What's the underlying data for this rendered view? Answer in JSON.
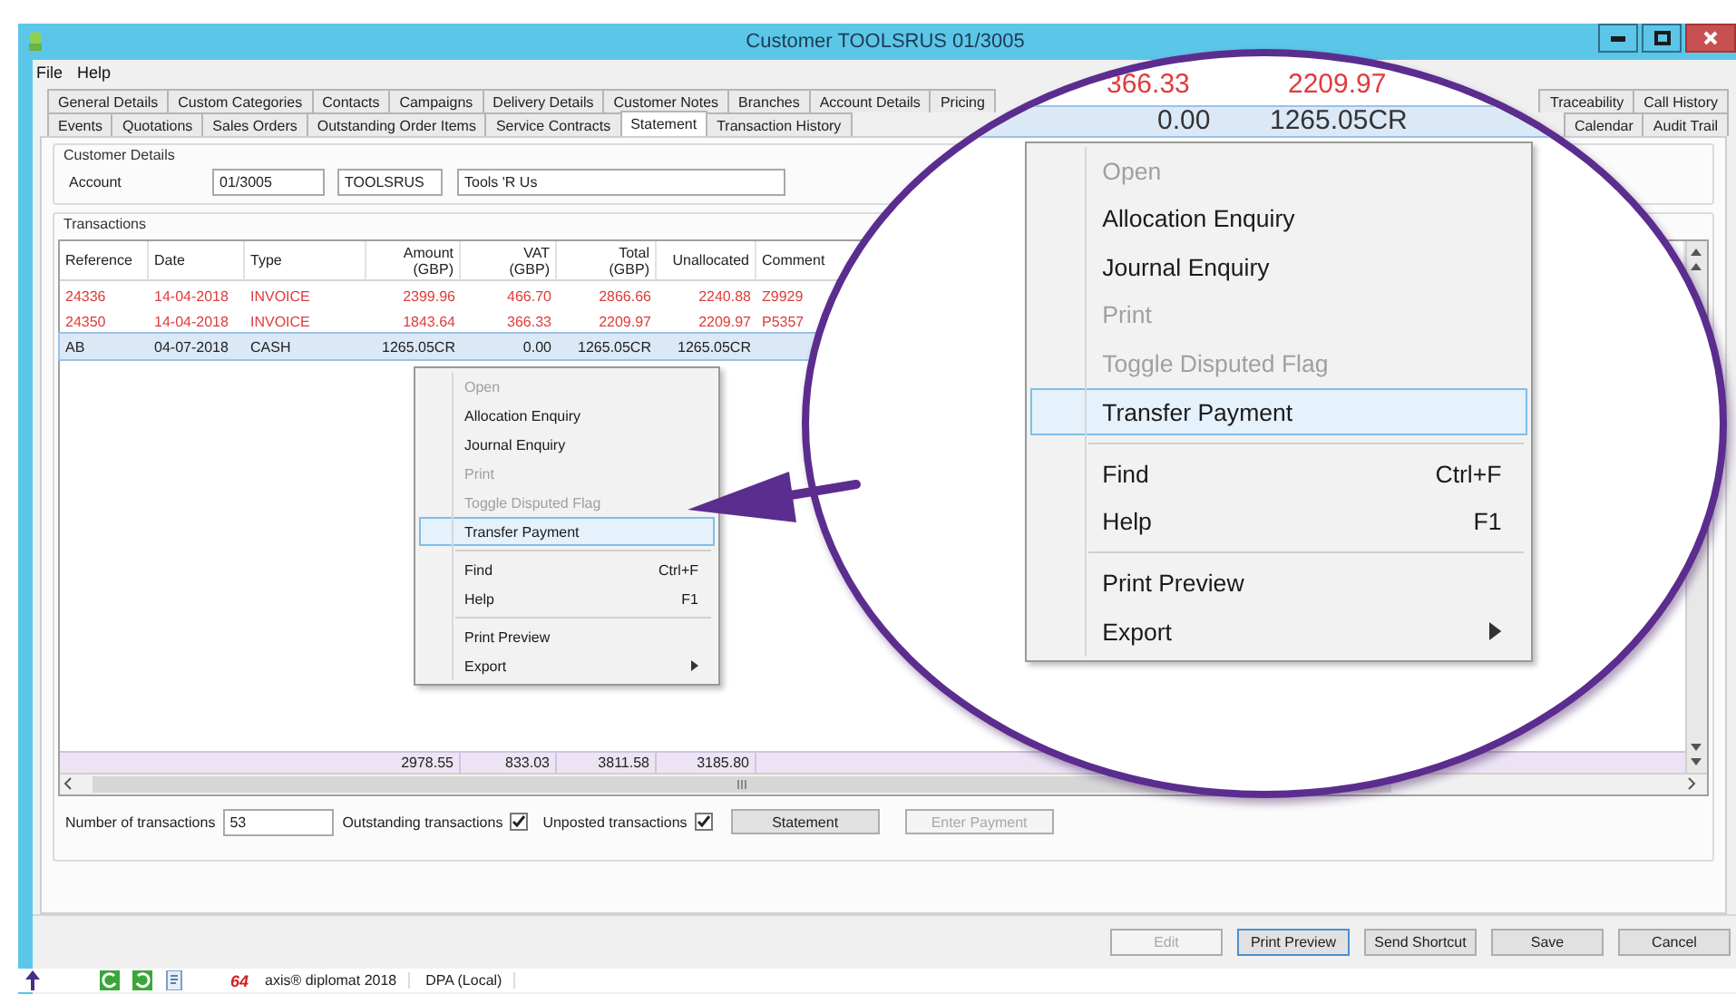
{
  "window": {
    "title": "Customer TOOLSRUS 01/3005"
  },
  "menu_bar": [
    "File",
    "Help"
  ],
  "tab_rows": [
    {
      "start": [
        {
          "label": "General Details",
          "selected": false
        },
        {
          "label": "Custom Categories",
          "selected": false
        },
        {
          "label": "Contacts",
          "selected": false
        },
        {
          "label": "Campaigns",
          "selected": false
        },
        {
          "label": "Delivery Details",
          "selected": false
        },
        {
          "label": "Customer Notes",
          "selected": false
        },
        {
          "label": "Branches",
          "selected": false
        },
        {
          "label": "Account Details",
          "selected": false
        },
        {
          "label": "Pricing",
          "selected": false
        }
      ],
      "end": [
        {
          "label": "Traceability",
          "selected": false
        },
        {
          "label": "Call History",
          "selected": false
        }
      ]
    },
    {
      "start": [
        {
          "label": "Events",
          "selected": false
        },
        {
          "label": "Quotations",
          "selected": false
        },
        {
          "label": "Sales Orders",
          "selected": false
        },
        {
          "label": "Outstanding Order Items",
          "selected": false
        },
        {
          "label": "Service Contracts",
          "selected": false
        },
        {
          "label": "Statement",
          "selected": true
        },
        {
          "label": "Transaction History",
          "selected": false
        }
      ],
      "end": [
        {
          "label": "Calendar",
          "selected": false
        },
        {
          "label": "Audit Trail",
          "selected": false
        }
      ]
    }
  ],
  "customer_details": {
    "title": "Customer Details",
    "label": "Account",
    "account": "01/3005",
    "code": "TOOLSRUS",
    "name": "Tools 'R Us"
  },
  "transactions": {
    "title": "Transactions",
    "columns": [
      {
        "label": "Reference",
        "right_aligned": false
      },
      {
        "label": "Date",
        "right_aligned": false
      },
      {
        "label": "Type",
        "right_aligned": false
      },
      {
        "label": "Amount",
        "sub": "(GBP)",
        "right_aligned": true
      },
      {
        "label": "VAT",
        "sub": "(GBP)",
        "right_aligned": true
      },
      {
        "label": "Total",
        "sub": "(GBP)",
        "right_aligned": true
      },
      {
        "label": "Unallocated",
        "right_aligned": true
      },
      {
        "label": "Comment",
        "right_aligned": false
      }
    ],
    "rows": [
      {
        "cells": [
          "24336",
          "14-04-2018",
          "INVOICE",
          "2399.96",
          "466.70",
          "2866.66",
          "2240.88",
          "Z9929"
        ],
        "overdue": true,
        "selected": false
      },
      {
        "cells": [
          "24350",
          "14-04-2018",
          "INVOICE",
          "1843.64",
          "366.33",
          "2209.97",
          "2209.97",
          "P5357"
        ],
        "overdue": true,
        "selected": false
      },
      {
        "cells": [
          "AB",
          "04-07-2018",
          "CASH",
          "1265.05CR",
          "0.00",
          "1265.05CR",
          "1265.05CR",
          null
        ],
        "overdue": false,
        "selected": true
      }
    ],
    "totals": {
      "amount": "2978.55",
      "vat": "833.03",
      "total": "3811.58",
      "unallocated": "3185.80"
    }
  },
  "controls": {
    "count_label": "Number of transactions",
    "count": "53",
    "outstanding_label": "Outstanding transactions",
    "outstanding": true,
    "unposted_label": "Unposted transactions",
    "unposted": true,
    "buttons": [
      {
        "label": "Statement",
        "disabled": false
      },
      {
        "label": "Enter Payment",
        "disabled": true
      }
    ]
  },
  "context_menu": [
    {
      "kind": "item",
      "label": "Open",
      "disabled": true,
      "selected": false
    },
    {
      "kind": "item",
      "label": "Allocation Enquiry",
      "disabled": false,
      "selected": false
    },
    {
      "kind": "item",
      "label": "Journal Enquiry",
      "disabled": false,
      "selected": false
    },
    {
      "kind": "item",
      "label": "Print",
      "disabled": true,
      "selected": false
    },
    {
      "kind": "item",
      "label": "Toggle Disputed Flag",
      "disabled": true,
      "selected": false
    },
    {
      "kind": "item",
      "label": "Transfer Payment",
      "disabled": false,
      "selected": true
    },
    {
      "kind": "separator"
    },
    {
      "kind": "item",
      "label": "Find",
      "shortcut": "Ctrl+F",
      "disabled": false,
      "selected": false
    },
    {
      "kind": "item",
      "label": "Help",
      "shortcut": "F1",
      "disabled": false,
      "selected": false
    },
    {
      "kind": "separator"
    },
    {
      "kind": "item",
      "label": "Print Preview",
      "disabled": false,
      "selected": false
    },
    {
      "kind": "submenu",
      "label": "Export",
      "disabled": false,
      "selected": false
    }
  ],
  "magnified_callout": {
    "vat_reading": "366.33",
    "total_reading": "2209.97",
    "row_vat": "0.00",
    "row_total": "1265.05CR",
    "menu": [
      {
        "kind": "item",
        "label": "Open",
        "disabled": true,
        "selected": false
      },
      {
        "kind": "item",
        "label": "Allocation Enquiry",
        "disabled": false,
        "selected": false
      },
      {
        "kind": "item",
        "label": "Journal Enquiry",
        "disabled": false,
        "selected": false
      },
      {
        "kind": "item",
        "label": "Print",
        "disabled": true,
        "selected": false
      },
      {
        "kind": "item",
        "label": "Toggle Disputed Flag",
        "disabled": true,
        "selected": false
      },
      {
        "kind": "item",
        "label": "Transfer Payment",
        "disabled": false,
        "selected": true
      },
      {
        "kind": "separator"
      },
      {
        "kind": "item",
        "label": "Find",
        "shortcut": "Ctrl+F",
        "disabled": false,
        "selected": false
      },
      {
        "kind": "item",
        "label": "Help",
        "shortcut": "F1",
        "disabled": false,
        "selected": false
      },
      {
        "kind": "separator"
      },
      {
        "kind": "item",
        "label": "Print Preview",
        "disabled": false,
        "selected": false
      },
      {
        "kind": "submenu",
        "label": "Export",
        "disabled": false,
        "selected": false
      }
    ]
  },
  "footer_buttons": [
    {
      "label": "Edit",
      "disabled": true,
      "focused": false
    },
    {
      "label": "Print Preview",
      "disabled": false,
      "focused": true
    },
    {
      "label": "Send Shortcut",
      "disabled": false,
      "focused": false
    },
    {
      "label": "Save",
      "disabled": false,
      "focused": false
    },
    {
      "label": "Cancel",
      "disabled": false,
      "focused": false
    }
  ],
  "status_bar": {
    "logo": "64",
    "product": "axis® diplomat 2018",
    "connection": "DPA (Local)"
  }
}
